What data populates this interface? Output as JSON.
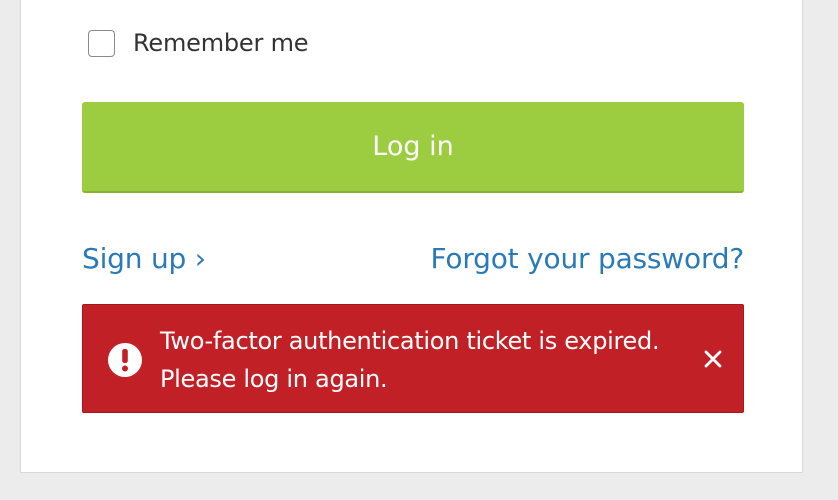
{
  "remember": {
    "label": "Remember me",
    "checked": false
  },
  "login_button": {
    "label": "Log in",
    "color": "#9ccc3f"
  },
  "links": {
    "signup": "Sign up ›",
    "forgot_password": "Forgot your password?"
  },
  "alert": {
    "icon": "exclamation-circle-icon",
    "line1": "Two-factor authentication ticket is expired.",
    "line2": "Please log in again.",
    "close_icon": "close-icon",
    "color": "#c12126"
  },
  "colors": {
    "link": "#2a7ab8",
    "background": "#ececec"
  }
}
